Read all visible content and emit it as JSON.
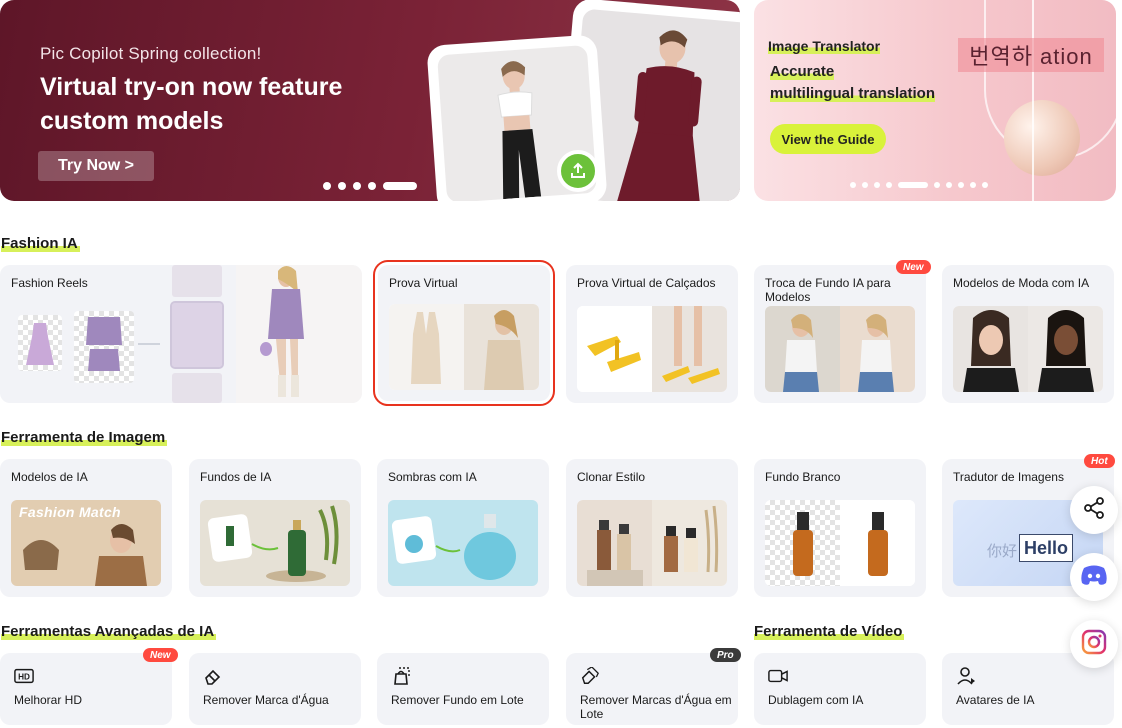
{
  "banner_main": {
    "subtitle": "Pic Copilot Spring collection!",
    "title": "Virtual try-on now feature custom models",
    "cta": "Try Now >",
    "active_dot": 5,
    "dot_count": 5
  },
  "banner_side": {
    "line1": "Image Translator",
    "line2": "Accurate",
    "line3": "multilingual translation",
    "overlay_text": "번역하 ation",
    "cta": "View the Guide"
  },
  "sections": {
    "fashion": "Fashion IA",
    "image_tools": "Ferramenta de Imagem",
    "advanced": "Ferramentas Avançadas de IA",
    "video": "Ferramenta de Vídeo"
  },
  "fashion_tiles": [
    {
      "label": "Fashion Reels"
    },
    {
      "label": "Prova Virtual"
    },
    {
      "label": "Prova Virtual de Calçados"
    },
    {
      "label": "Troca de Fundo IA para Modelos",
      "badge": "New"
    },
    {
      "label": "Modelos de Moda com IA"
    }
  ],
  "image_tiles": [
    {
      "label": "Modelos de IA",
      "overlay": "Fashion Match"
    },
    {
      "label": "Fundos de IA"
    },
    {
      "label": "Sombras com IA"
    },
    {
      "label": "Clonar Estilo"
    },
    {
      "label": "Fundo Branco"
    },
    {
      "label": "Tradutor de Imagens",
      "badge": "Hot",
      "overlay_cn": "你好",
      "overlay_en": "Hello"
    }
  ],
  "advanced_tiles": [
    {
      "label": "Melhorar HD",
      "badge": "New",
      "icon": "hd-icon"
    },
    {
      "label": "Remover Marca d'Água",
      "icon": "eraser-icon"
    },
    {
      "label": "Remover Fundo em Lote",
      "icon": "batch-bag-icon"
    },
    {
      "label": "Remover Marcas d'Água em Lote",
      "badge": "Pro",
      "icon": "batch-eraser-icon"
    }
  ],
  "video_tiles": [
    {
      "label": "Dublagem com IA",
      "icon": "video-camera-icon"
    },
    {
      "label": "Avatares de IA",
      "icon": "avatar-icon"
    }
  ],
  "colors": {
    "accent_highlight": "#d7f05a",
    "badge_red": "#ff4a3f",
    "selection_red": "#e8331e",
    "banner_main_bg": "#6e1d31"
  }
}
